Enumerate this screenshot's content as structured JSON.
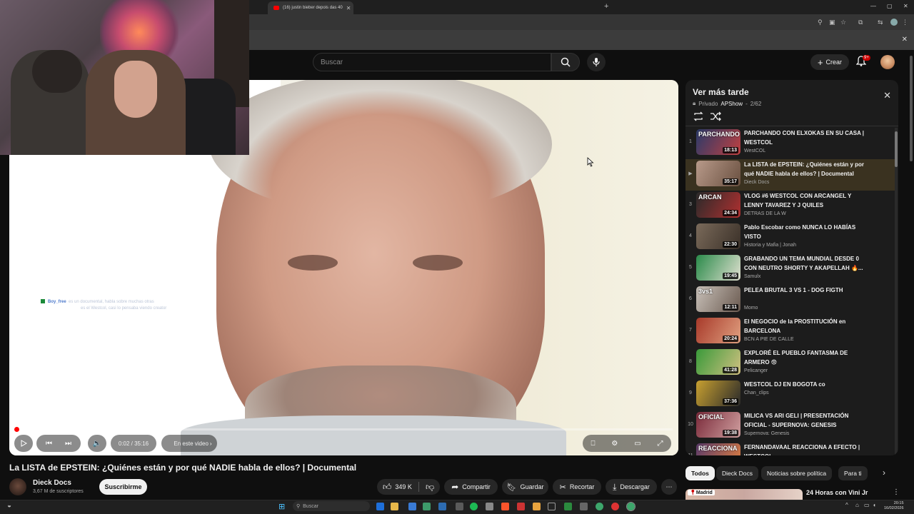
{
  "browser": {
    "tab_title": "(16) justin bieber depois das 40",
    "new_tab_symbol": "+"
  },
  "header": {
    "search_placeholder": "Buscar",
    "create_label": "Crear",
    "notif_count": "9+"
  },
  "player": {
    "chat_user": "Boy_free",
    "chat_line1": "es un documental, habla sobre muchas otras",
    "chat_line2": "es el Westcol, casi lo pensaba viendo creator",
    "time_label": "0:02 / 35:16",
    "chapter_label": "En este video",
    "progress_fraction": 0.001
  },
  "video": {
    "title": "La LISTA de EPSTEIN: ¿Quiénes están y por qué NADIE habla de ellos? | Documental",
    "channel": "Dieck Docs",
    "subscribers": "3,67 M de suscriptores",
    "subscribe_label": "Suscribirme",
    "likes": "349 K",
    "share_label": "Compartir",
    "save_label": "Guardar",
    "clip_label": "Recortar",
    "download_label": "Descargar"
  },
  "playlist": {
    "title": "Ver más tarde",
    "privacy": "Privado",
    "owner": "APShow",
    "position": "2/62",
    "items": [
      {
        "index": "1",
        "title": "PARCHANDO CON ELXOKAS EN SU CASA | WESTCOL",
        "channel": "WestCOL",
        "duration": "18:13",
        "active": false,
        "thumb_text": "PARCHANDO"
      },
      {
        "index": "▶",
        "title": "La LISTA de EPSTEIN: ¿Quiénes están y por qué NADIE habla de ellos? | Documental",
        "channel": "Dieck Docs",
        "duration": "35:17",
        "active": true,
        "thumb_text": ""
      },
      {
        "index": "3",
        "title": "VLOG #6 WESTCOL CON ARCANGEL Y LENNY TAVAREZ Y J QUILES",
        "channel": "DETRAS DE LA W",
        "duration": "24:34",
        "active": false,
        "thumb_text": "ARCAN"
      },
      {
        "index": "4",
        "title": "Pablo Escobar como NUNCA LO HABÍAS VISTO",
        "channel": "Historia y Mafia | Jonah",
        "duration": "22:30",
        "active": false,
        "thumb_text": ""
      },
      {
        "index": "5",
        "title": "GRABANDO UN TEMA MUNDIAL DESDE 0 CON NEUTRO SHORTY Y AKAPELLAH 🔥...",
        "channel": "Samulx",
        "duration": "19:45",
        "active": false,
        "thumb_text": ""
      },
      {
        "index": "6",
        "title": "PELEA BRUTAL 3 VS 1 - DOG FIGTH",
        "channel": "Momo",
        "duration": "12:11",
        "active": false,
        "thumb_text": "3vs1"
      },
      {
        "index": "7",
        "title": "El NEGOCIO de la PROSTITUCIÓN en BARCELONA",
        "channel": "BCN A PIE DE CALLE",
        "duration": "20:24",
        "active": false,
        "thumb_text": ""
      },
      {
        "index": "8",
        "title": "EXPLORÉ EL PUEBLO FANTASMA DE ARMERO 😨",
        "channel": "Pelicanger",
        "duration": "41:28",
        "active": false,
        "thumb_text": ""
      },
      {
        "index": "9",
        "title": "WESTCOL DJ EN BOGOTA co",
        "channel": "Chan_clips",
        "duration": "37:36",
        "active": false,
        "thumb_text": ""
      },
      {
        "index": "10",
        "title": "MILICA VS ARI GELI | PRESENTACIÓN OFICIAL - SUPERNOVA: GENESIS",
        "channel": "Supernova: Genesis",
        "duration": "19:38",
        "active": false,
        "thumb_text": "OFICIAL"
      },
      {
        "index": "11",
        "title": "FERNANDAVAAL REACCIONA A EFECTO | WESTCOL",
        "channel": "",
        "duration": "10:20",
        "active": false,
        "thumb_text": "REACCIONA"
      }
    ]
  },
  "chips": [
    "Todos",
    "Dieck Docs",
    "Noticias sobre política",
    "Para ti"
  ],
  "recommended": {
    "badge": "Madrid",
    "title": "24 Horas con Vini Jr"
  },
  "taskbar": {
    "search_label": "Buscar",
    "time": "20:15",
    "date": "16/02/2026"
  },
  "colors": {
    "yt_red": "#ff0000",
    "bg": "#0f0f0f",
    "panel": "#1c1c1c"
  }
}
